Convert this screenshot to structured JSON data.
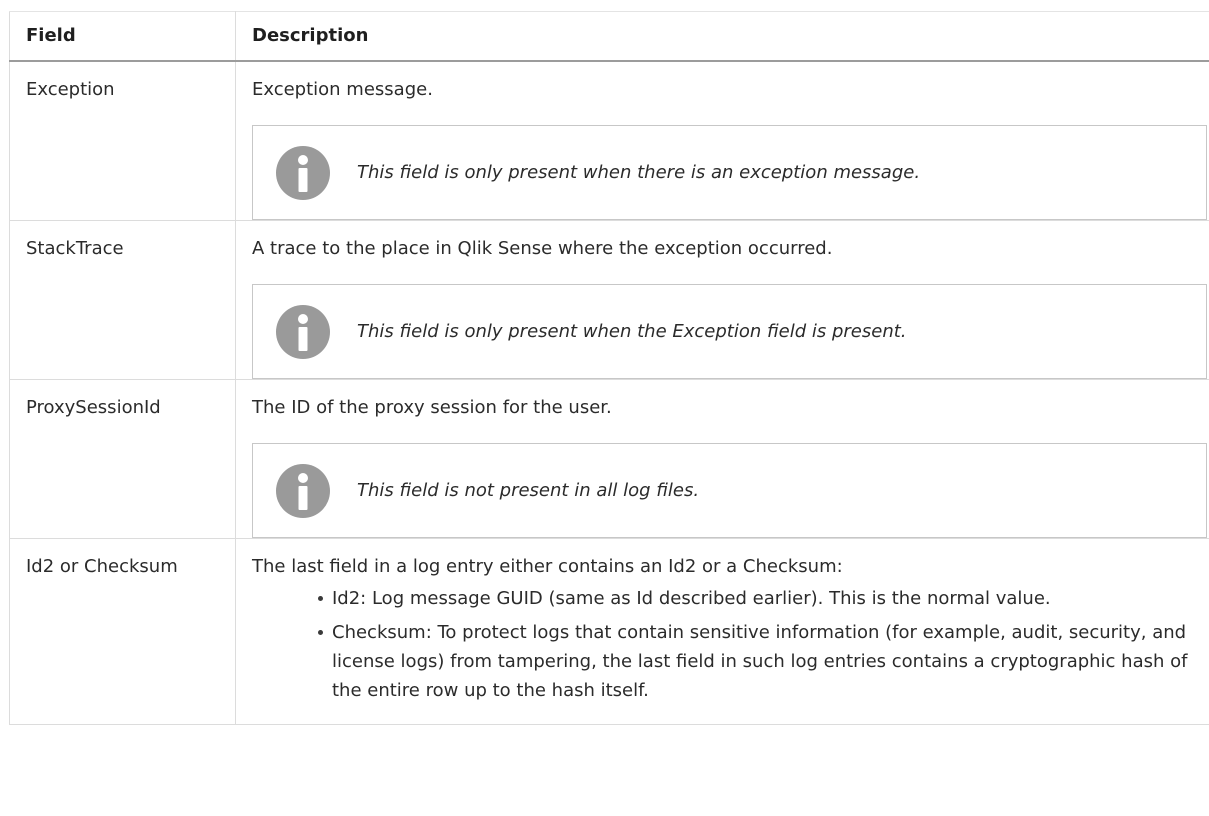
{
  "table": {
    "headers": {
      "field": "Field",
      "description": "Description"
    },
    "rows": [
      {
        "field": "Exception",
        "description": "Exception message.",
        "note": "This field is only present when there is an exception message."
      },
      {
        "field": "StackTrace",
        "description": "A trace to the place in Qlik Sense where the exception occurred.",
        "note": "This field is only present when the Exception field is present."
      },
      {
        "field": "ProxySessionId",
        "description": "The ID of the proxy session for the user.",
        "note": "This field is not present in all log files."
      },
      {
        "field": "Id2 or Checksum",
        "description": "The last field in a log entry either contains an Id2 or a Checksum:",
        "bullets": [
          "Id2: Log message GUID (same as Id described earlier). This is the normal value.",
          "Checksum: To protect logs that contain sensitive information (for example, audit, security, and license logs) from tampering, the last field in such log entries contains a cryptographic hash of the entire row up to the hash itself."
        ]
      }
    ]
  },
  "icons": {
    "note": "info-icon",
    "note_color": "#9a9a9a"
  }
}
